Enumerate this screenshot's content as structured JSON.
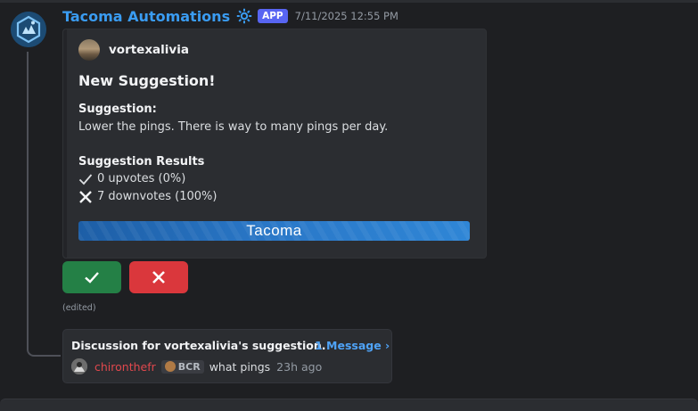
{
  "message": {
    "author": "Tacoma Automations",
    "app_tag": "APP",
    "timestamp": "7/11/2025 12:55 PM",
    "edited_label": "(edited)"
  },
  "embed": {
    "author_name": "vortexalivia",
    "title": "New Suggestion!",
    "suggestion_label": "Suggestion:",
    "suggestion_text": "Lower the pings. There is way to many pings per day.",
    "results_label": "Suggestion Results",
    "upvotes_text": "0 upvotes (0%)",
    "downvotes_text": "7 downvotes (100%)",
    "banner_text": "Tacoma"
  },
  "buttons": {
    "upvote_icon": "check-icon",
    "downvote_icon": "x-icon",
    "upvote_color": "#248046",
    "downvote_color": "#da373c"
  },
  "thread": {
    "title": "Discussion for vortexalivia's suggestion.",
    "message_count": "1 Message ›",
    "reply_author": "chironthefr",
    "reply_role": "BCR",
    "reply_text": "what pings",
    "reply_time": "23h ago"
  },
  "colors": {
    "accent_link": "#4fa3f7",
    "author_name": "#3a9cf2",
    "app_tag_bg": "#5865f2",
    "reply_author": "#e0484d"
  }
}
